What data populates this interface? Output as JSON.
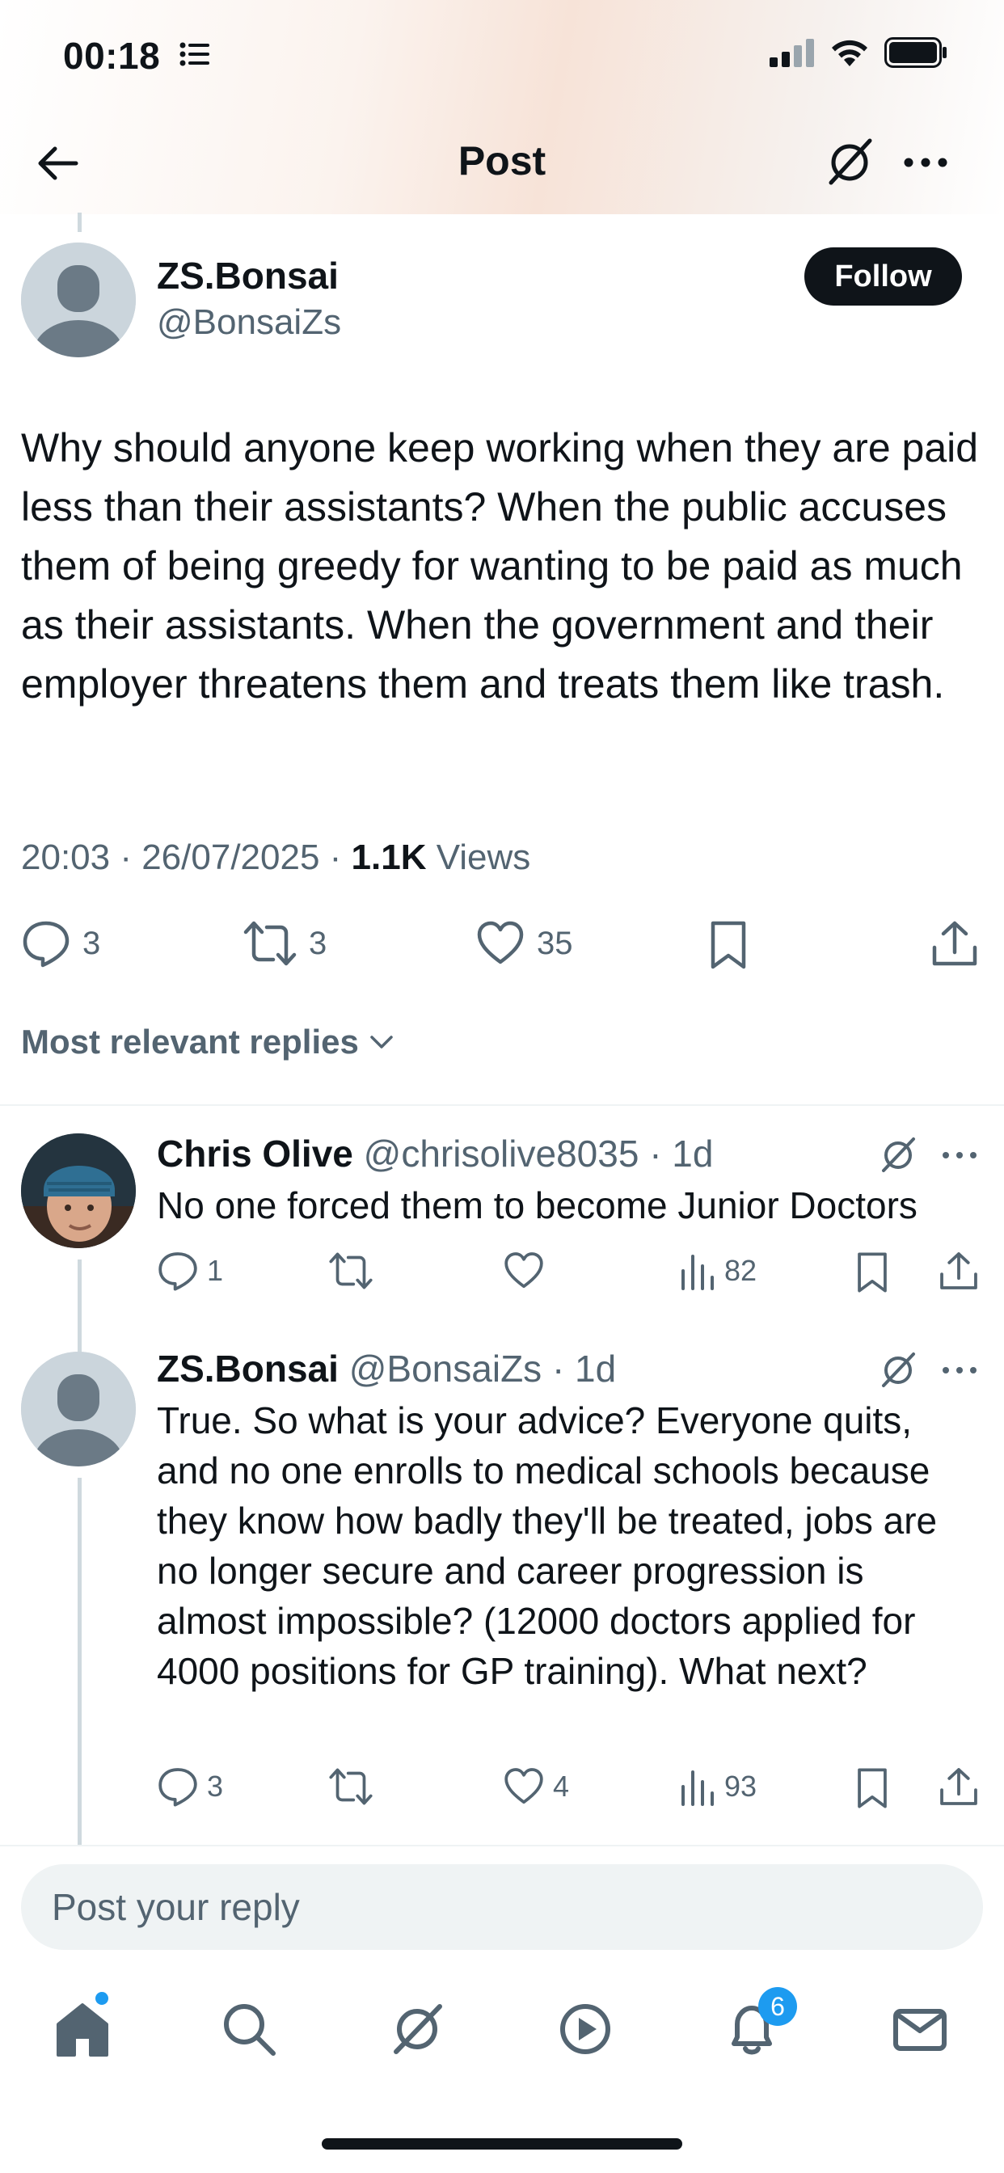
{
  "status_bar": {
    "time": "00:18"
  },
  "header": {
    "title": "Post"
  },
  "main_post": {
    "author_name": "ZS.Bonsai",
    "author_handle": "@BonsaiZs",
    "follow_label": "Follow",
    "text": "Why should anyone keep working when they are paid less than their assistants? When the public accuses them of being greedy for wanting to be paid as much as their assistants. When the government and their employer threatens them and treats them like trash.",
    "timestamp": "20:03 · 26/07/2025 · ",
    "views_count": "1.1K",
    "views_label": " Views",
    "replies": "3",
    "reposts": "3",
    "likes": "35"
  },
  "sort_label": "Most relevant replies",
  "replies": [
    {
      "name": "Chris Olive",
      "handle": "@chrisolive8035",
      "time": " · 1d",
      "text": "No one forced them to become Junior Doctors",
      "replies": "1",
      "reposts": "",
      "likes": "",
      "views": "82"
    },
    {
      "name": "ZS.Bonsai",
      "handle": "@BonsaiZs",
      "time": " · 1d",
      "text": "True. So what is your advice? Everyone quits, and no one enrolls to medical schools because they know how badly they'll be treated, jobs are no longer secure and career progression is almost impossible? (12000 doctors applied for 4000 positions for GP training). What next?",
      "replies": "3",
      "reposts": "",
      "likes": "4",
      "views": "93"
    }
  ],
  "reply_box": {
    "placeholder": "Post your reply"
  },
  "tab_bar": {
    "notifications_badge": "6"
  },
  "colors": {
    "accent": "#1d9bf0",
    "text": "#0f1419",
    "secondary": "#536471",
    "border": "#eff3f4"
  }
}
